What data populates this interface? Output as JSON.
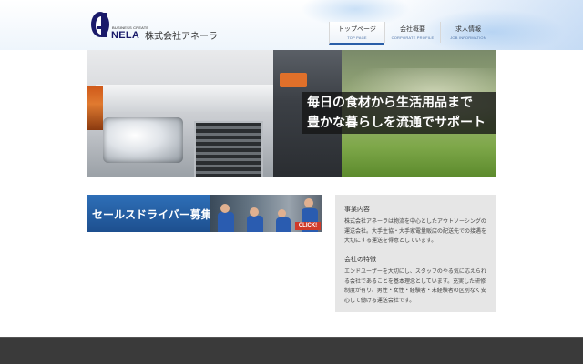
{
  "brand": {
    "logo_small_text": "BUSINESS CREATE",
    "logo_word": "NELA",
    "company_name": "株式会社アネーラ",
    "brand_color": "#1a1a6a"
  },
  "nav": {
    "items": [
      {
        "label": "トップページ",
        "sublabel": "TOP PAGE",
        "active": true
      },
      {
        "label": "会社概要",
        "sublabel": "CORPORATE PROFILE",
        "active": false
      },
      {
        "label": "求人情報",
        "sublabel": "JOB INFORMATION",
        "active": false
      }
    ],
    "active_color": "#2a5ea8"
  },
  "hero": {
    "caption_line1": "毎日の食材から生活用品まで",
    "caption_line2": "豊かな暮らしを流通でサポート"
  },
  "recruit_banner": {
    "title": "セールスドライバー募集",
    "click_label": "CLICK!",
    "accent_color": "#d03a2a"
  },
  "info": {
    "business_title": "事業内容",
    "business_body": "株式会社アネーラは物流を中心としたアウトソーシングの運送会社。大手生協・大手家電量販店の配送先での接遇を大切にする運送を得意としています。",
    "features_title": "会社の特徴",
    "features_body": "エンドユーザーを大切にし、スタッフのやる気に応えられる会社であることを基本理念としています。充実した研修制度が有り、男性・女性・経験者・未経験者の区別なく安心して働ける運送会社です。"
  }
}
